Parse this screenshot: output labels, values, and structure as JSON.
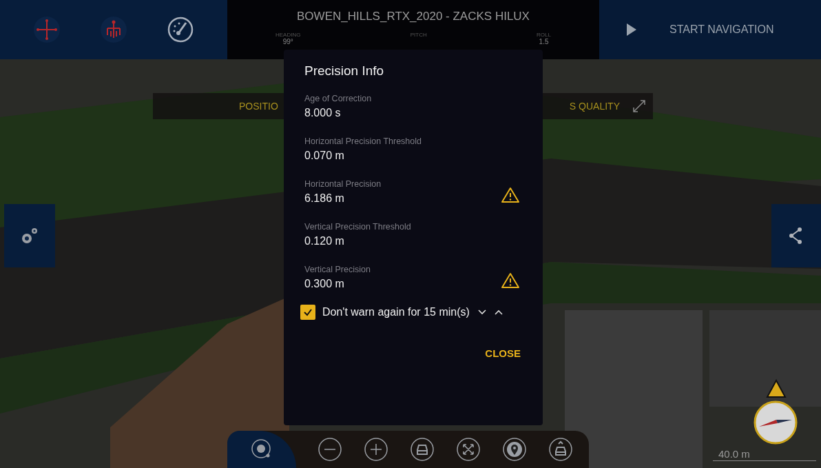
{
  "window": {
    "title": "BOWEN_HILLS_RTX_2020 - ZACKS HILUX"
  },
  "readouts": [
    {
      "label": "HEADING",
      "value": "99°"
    },
    {
      "label": "PITCH"
    },
    {
      "label": "ROLL",
      "value": "1.5"
    }
  ],
  "start_navigation": {
    "label": "START NAVIGATION"
  },
  "banner": {
    "left": "POSITIO",
    "right": "S QUALITY"
  },
  "dialog": {
    "title": "Precision Info",
    "fields": [
      {
        "label": "Age of Correction",
        "value": "8.000 s",
        "warning": false
      },
      {
        "label": "Horizontal Precision Threshold",
        "value": "0.070 m",
        "warning": false
      },
      {
        "label": "Horizontal Precision",
        "value": "6.186 m",
        "warning": true
      },
      {
        "label": "Vertical Precision Threshold",
        "value": "0.120 m",
        "warning": false
      },
      {
        "label": "Vertical Precision",
        "value": "0.300 m",
        "warning": true
      }
    ],
    "dont_warn": {
      "checked": true,
      "text": "Don't warn again for 15 min(s)"
    },
    "close": "CLOSE"
  },
  "scale": "40.0 m"
}
